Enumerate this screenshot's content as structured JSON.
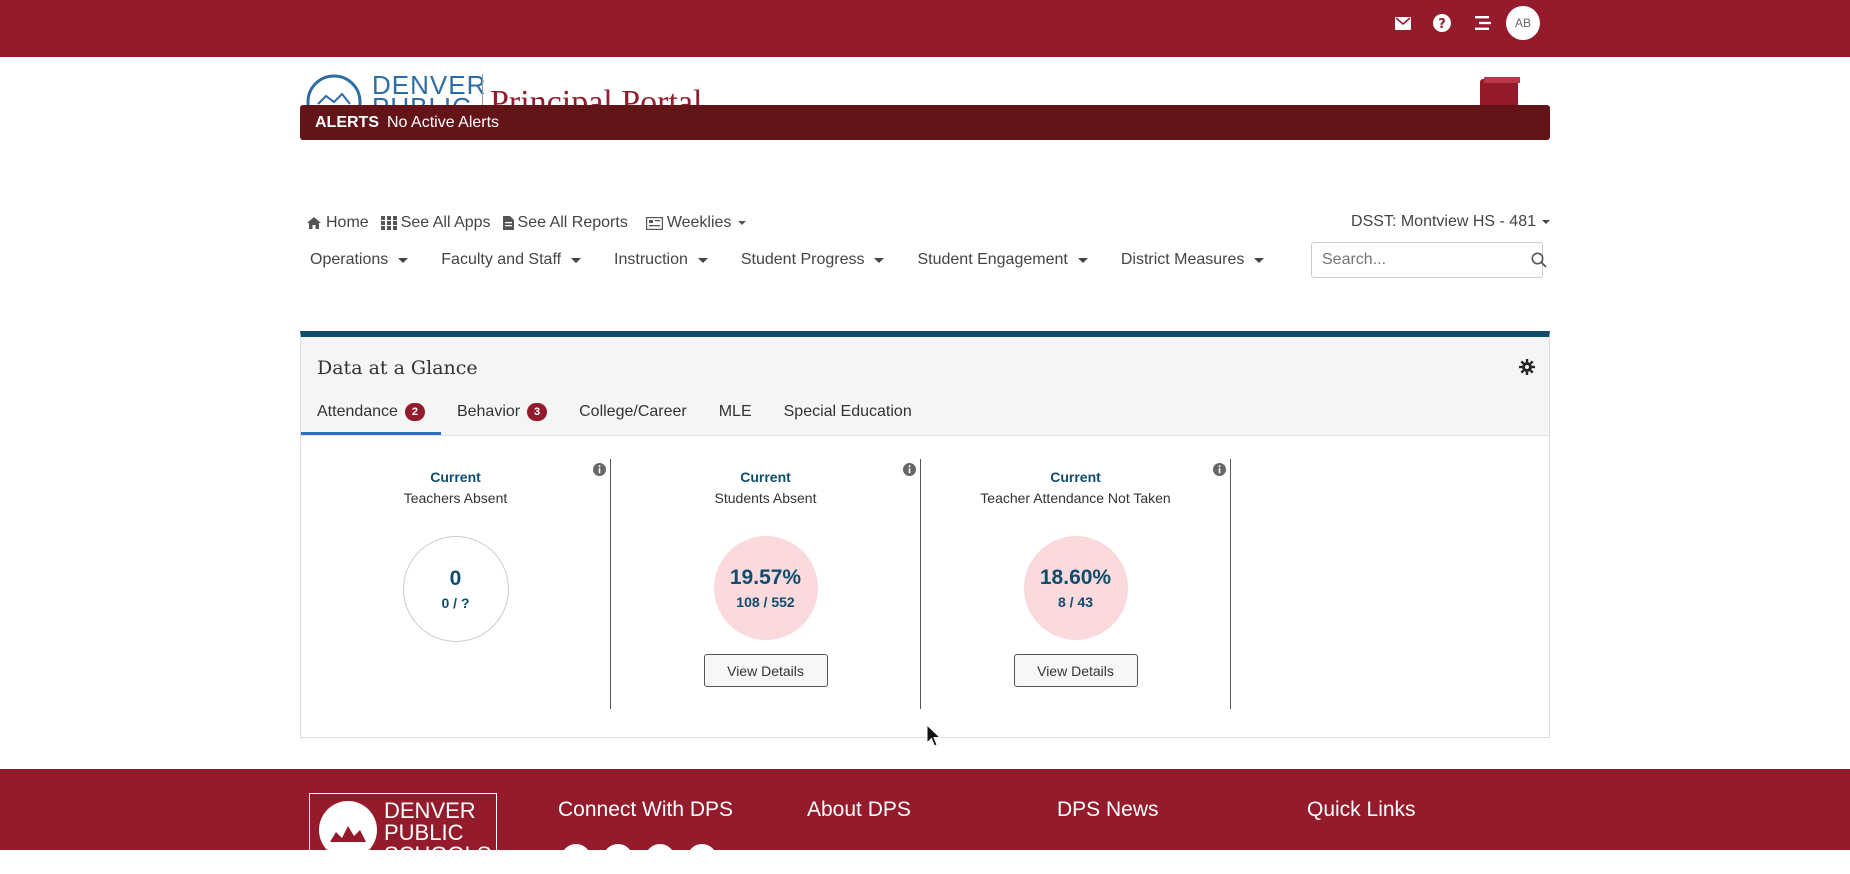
{
  "header": {
    "icons": [
      "envelope-icon",
      "question-icon",
      "list-icon"
    ],
    "avatar_initials": "AB",
    "logo_text": "DENVER PUBLIC",
    "portal_title": "Principal Portal"
  },
  "alerts": {
    "label": "ALERTS",
    "text": "No Active Alerts"
  },
  "subnav": {
    "home": "Home",
    "apps": "See All Apps",
    "reports": "See All Reports",
    "weeklies": "Weeklies",
    "school": "DSST: Montview HS - 481"
  },
  "mainnav": [
    {
      "label": "Operations"
    },
    {
      "label": "Faculty and Staff"
    },
    {
      "label": "Instruction"
    },
    {
      "label": "Student Progress"
    },
    {
      "label": "Student Engagement"
    },
    {
      "label": "District Measures"
    }
  ],
  "search": {
    "placeholder": "Search..."
  },
  "panel": {
    "title": "Data at a Glance",
    "tabs": [
      {
        "label": "Attendance",
        "badge": "2",
        "active": true
      },
      {
        "label": "Behavior",
        "badge": "3"
      },
      {
        "label": "College/Career"
      },
      {
        "label": "MLE"
      },
      {
        "label": "Special Education"
      }
    ],
    "cards": [
      {
        "heading": "Current",
        "subheading": "Teachers Absent",
        "value": "0",
        "fraction": "0 / ?",
        "style": "plain"
      },
      {
        "heading": "Current",
        "subheading": "Students Absent",
        "value": "19.57%",
        "fraction": "108 / 552",
        "style": "pink",
        "button": "View Details"
      },
      {
        "heading": "Current",
        "subheading": "Teacher Attendance Not Taken",
        "value": "18.60%",
        "fraction": "8 / 43",
        "style": "pink",
        "button": "View Details"
      }
    ]
  },
  "footer": {
    "logo_text": "DENVER PUBLIC SCHOOLS",
    "columns": [
      "Connect With DPS",
      "About DPS",
      "DPS News",
      "Quick Links"
    ]
  },
  "colors": {
    "brand": "#941b2b",
    "alert_bg": "#621418",
    "accent": "#0f4c6e",
    "tab_active": "#2d6fc7"
  }
}
